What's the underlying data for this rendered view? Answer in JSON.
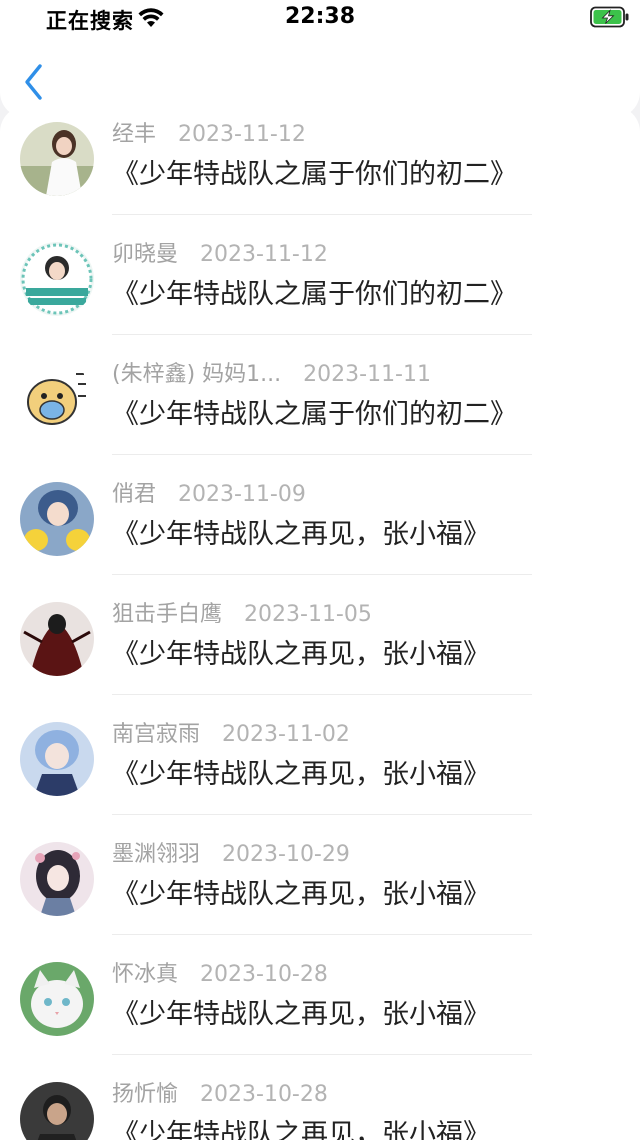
{
  "status_bar": {
    "carrier": "正在搜索",
    "time": "22:38",
    "wifi_icon": "wifi-icon",
    "battery_icon": "battery-charging-icon"
  },
  "nav": {
    "back_icon": "chevron-left-icon",
    "accent_color": "#2f8fe8"
  },
  "comments": [
    {
      "name": "经丰",
      "date": "2023-11-12",
      "title": "《少年特战队之属于你们的初二》",
      "avatar": "avatar-girl-white-dress"
    },
    {
      "name": "卯晓曼",
      "date": "2023-11-12",
      "title": "《少年特战队之属于你们的初二》",
      "avatar": "avatar-birthday-badge"
    },
    {
      "name": "(朱梓鑫) 妈妈1...",
      "date": "2023-11-11",
      "title": "《少年特战队之属于你们的初二》",
      "avatar": "avatar-cartoon-dog-sticker"
    },
    {
      "name": "俏君",
      "date": "2023-11-09",
      "title": "《少年特战队之再见，张小福》",
      "avatar": "avatar-anime-boy-pikachu"
    },
    {
      "name": "狙击手白鹰",
      "date": "2023-11-05",
      "title": "《少年特战队之再见，张小福》",
      "avatar": "avatar-dark-red-character"
    },
    {
      "name": "南宫寂雨",
      "date": "2023-11-02",
      "title": "《少年特战队之再见，张小福》",
      "avatar": "avatar-anime-blue-hair"
    },
    {
      "name": "墨渊翎羽",
      "date": "2023-10-29",
      "title": "《少年特战队之再见，张小福》",
      "avatar": "avatar-anime-girl-flowers"
    },
    {
      "name": "怀冰真",
      "date": "2023-10-28",
      "title": "《少年特战队之再见，张小福》",
      "avatar": "avatar-white-cat"
    },
    {
      "name": "扬忻愉",
      "date": "2023-10-28",
      "title": "《少年特战队之再见，张小福》",
      "avatar": "avatar-boy-photo"
    }
  ]
}
